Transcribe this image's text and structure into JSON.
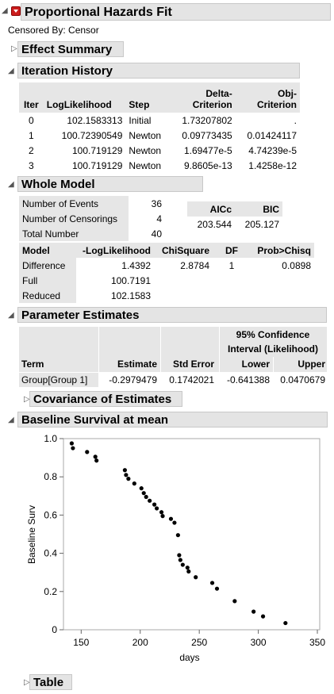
{
  "report": {
    "title": "Proportional Hazards Fit",
    "censored_by": "Censored By: Censor"
  },
  "effect_summary": {
    "title": "Effect Summary"
  },
  "iteration_history": {
    "title": "Iteration History",
    "headers": [
      "Iter",
      "LogLikelihood",
      "Step",
      "Delta-\nCriterion",
      "Obj-\nCriterion"
    ],
    "header_lines": [
      [
        "Iter"
      ],
      [
        "LogLikelihood"
      ],
      [
        "Step"
      ],
      [
        "Delta-",
        "Criterion"
      ],
      [
        "Obj-",
        "Criterion"
      ]
    ],
    "rows": [
      [
        "0",
        "102.1583313",
        "Initial",
        "1.73207802",
        "."
      ],
      [
        "1",
        "100.72390549",
        "Newton",
        "0.09773435",
        "0.01424117"
      ],
      [
        "2",
        "100.719129",
        "Newton",
        "1.69477e-5",
        "4.74239e-5"
      ],
      [
        "3",
        "100.719129",
        "Newton",
        "9.8605e-13",
        "1.4258e-12"
      ]
    ]
  },
  "whole_model": {
    "title": "Whole Model",
    "counts": [
      {
        "label": "Number of Events",
        "value": "36"
      },
      {
        "label": "Number of Censorings",
        "value": "4"
      },
      {
        "label": "Total Number",
        "value": "40"
      }
    ],
    "ic_headers": [
      "AICc",
      "BIC"
    ],
    "ic_values": [
      "203.544",
      "205.127"
    ],
    "model_headers": [
      "Model",
      "-LogLikelihood",
      "ChiSquare",
      "DF",
      "Prob>Chisq"
    ],
    "model_rows": [
      [
        "Difference",
        "1.4392",
        "2.8784",
        "1",
        "0.0898"
      ],
      [
        "Full",
        "100.7191",
        "",
        "",
        ""
      ],
      [
        "Reduced",
        "102.1583",
        "",
        "",
        ""
      ]
    ]
  },
  "parameter_estimates": {
    "title": "Parameter Estimates",
    "ci_header_line1": "95% Confidence",
    "ci_header_line2": "Interval (Likelihood)",
    "headers": [
      "Term",
      "Estimate",
      "Std Error",
      "Lower",
      "Upper"
    ],
    "row": [
      "Group[Group 1]",
      "-0.2979479",
      "0.1742021",
      "-0.641388",
      "0.0470679"
    ]
  },
  "covariance": {
    "title": "Covariance of Estimates"
  },
  "baseline": {
    "title": "Baseline Survival at mean"
  },
  "table_section": {
    "title": "Table"
  },
  "chart_data": {
    "type": "scatter",
    "title": "",
    "xlabel": "days",
    "ylabel": "Baseline Surv",
    "xlim": [
      135,
      352
    ],
    "ylim": [
      0,
      1.0
    ],
    "xticks": [
      "150",
      "200",
      "250",
      "300",
      "350"
    ],
    "yticks": [
      "0",
      "0.2",
      "0.4",
      "0.6",
      "0.8",
      "1.0"
    ],
    "grid": false,
    "points": [
      [
        142,
        0.975
      ],
      [
        143,
        0.95
      ],
      [
        155,
        0.93
      ],
      [
        162,
        0.905
      ],
      [
        163,
        0.885
      ],
      [
        187,
        0.835
      ],
      [
        188,
        0.81
      ],
      [
        190,
        0.79
      ],
      [
        195,
        0.765
      ],
      [
        201,
        0.74
      ],
      [
        203,
        0.715
      ],
      [
        205,
        0.695
      ],
      [
        208,
        0.675
      ],
      [
        212,
        0.655
      ],
      [
        214,
        0.635
      ],
      [
        218,
        0.615
      ],
      [
        219,
        0.595
      ],
      [
        226,
        0.58
      ],
      [
        229,
        0.56
      ],
      [
        232,
        0.495
      ],
      [
        233,
        0.39
      ],
      [
        234,
        0.365
      ],
      [
        236,
        0.34
      ],
      [
        240,
        0.325
      ],
      [
        241,
        0.305
      ],
      [
        247,
        0.275
      ],
      [
        261,
        0.245
      ],
      [
        265,
        0.215
      ],
      [
        280,
        0.15
      ],
      [
        296,
        0.095
      ],
      [
        304,
        0.07
      ],
      [
        323,
        0.035
      ]
    ]
  }
}
